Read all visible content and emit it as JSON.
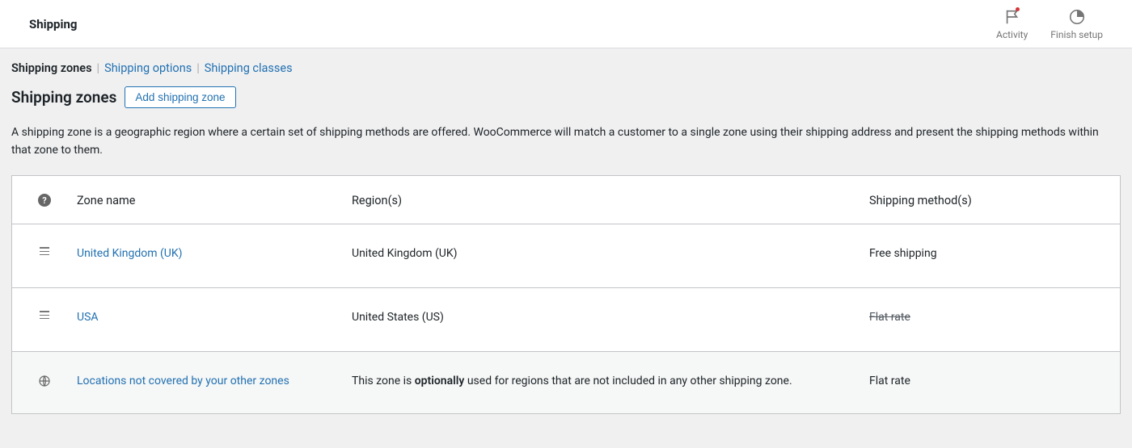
{
  "header": {
    "title": "Shipping",
    "activity_label": "Activity",
    "finish_label": "Finish setup"
  },
  "subnav": {
    "zones": "Shipping zones",
    "options": "Shipping options",
    "classes": "Shipping classes"
  },
  "page": {
    "title": "Shipping zones",
    "add_button": "Add shipping zone",
    "description": "A shipping zone is a geographic region where a certain set of shipping methods are offered. WooCommerce will match a customer to a single zone using their shipping address and present the shipping methods within that zone to them."
  },
  "table": {
    "headers": {
      "name": "Zone name",
      "region": "Region(s)",
      "method": "Shipping method(s)"
    },
    "rows": [
      {
        "name": "United Kingdom (UK)",
        "region": "United Kingdom (UK)",
        "method": "Free shipping",
        "method_strike": false
      },
      {
        "name": "USA",
        "region": "United States (US)",
        "method": "Flat rate",
        "method_strike": true
      }
    ],
    "footer": {
      "name": "Locations not covered by your other zones",
      "region_prefix": "This zone is ",
      "region_bold": "optionally",
      "region_suffix": " used for regions that are not included in any other shipping zone.",
      "method": "Flat rate"
    }
  }
}
